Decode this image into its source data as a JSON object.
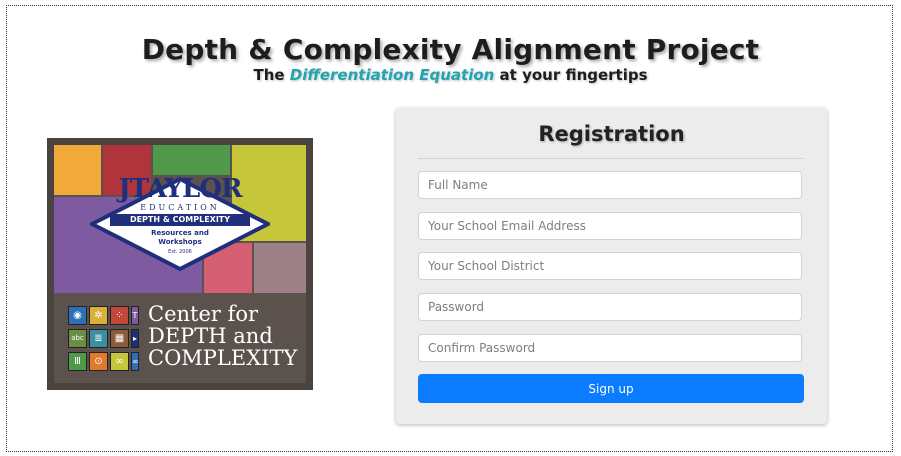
{
  "header": {
    "title": "Depth & Complexity Alignment Project",
    "tagline_before": "The ",
    "tagline_emphasis": "Differentiation Equation",
    "tagline_after": " at your fingertips"
  },
  "logo": {
    "brand_main": "JTAYLOR",
    "brand_sub": "EDUCATION",
    "banner": "DEPTH & COMPLEXITY",
    "resources": "Resources and Workshops",
    "est": "Est. 2006",
    "center_line1": "Center for",
    "center_line2": "DEPTH and",
    "center_line3": "COMPLEXITY",
    "colors": {
      "orange": "#f2a93b",
      "red": "#b0343b",
      "green": "#4e9a4a",
      "lime": "#c6c63a",
      "purple": "#7e5aa0",
      "pink": "#d45e72",
      "mauve": "#9d8088",
      "navy": "#1f2f7c",
      "dark": "#5c524d"
    }
  },
  "registration": {
    "title": "Registration",
    "fields": {
      "full_name": "Full Name",
      "email": "Your School Email Address",
      "district": "Your School District",
      "password": "Password",
      "confirm_password": "Confirm Password"
    },
    "submit_label": "Sign up"
  }
}
